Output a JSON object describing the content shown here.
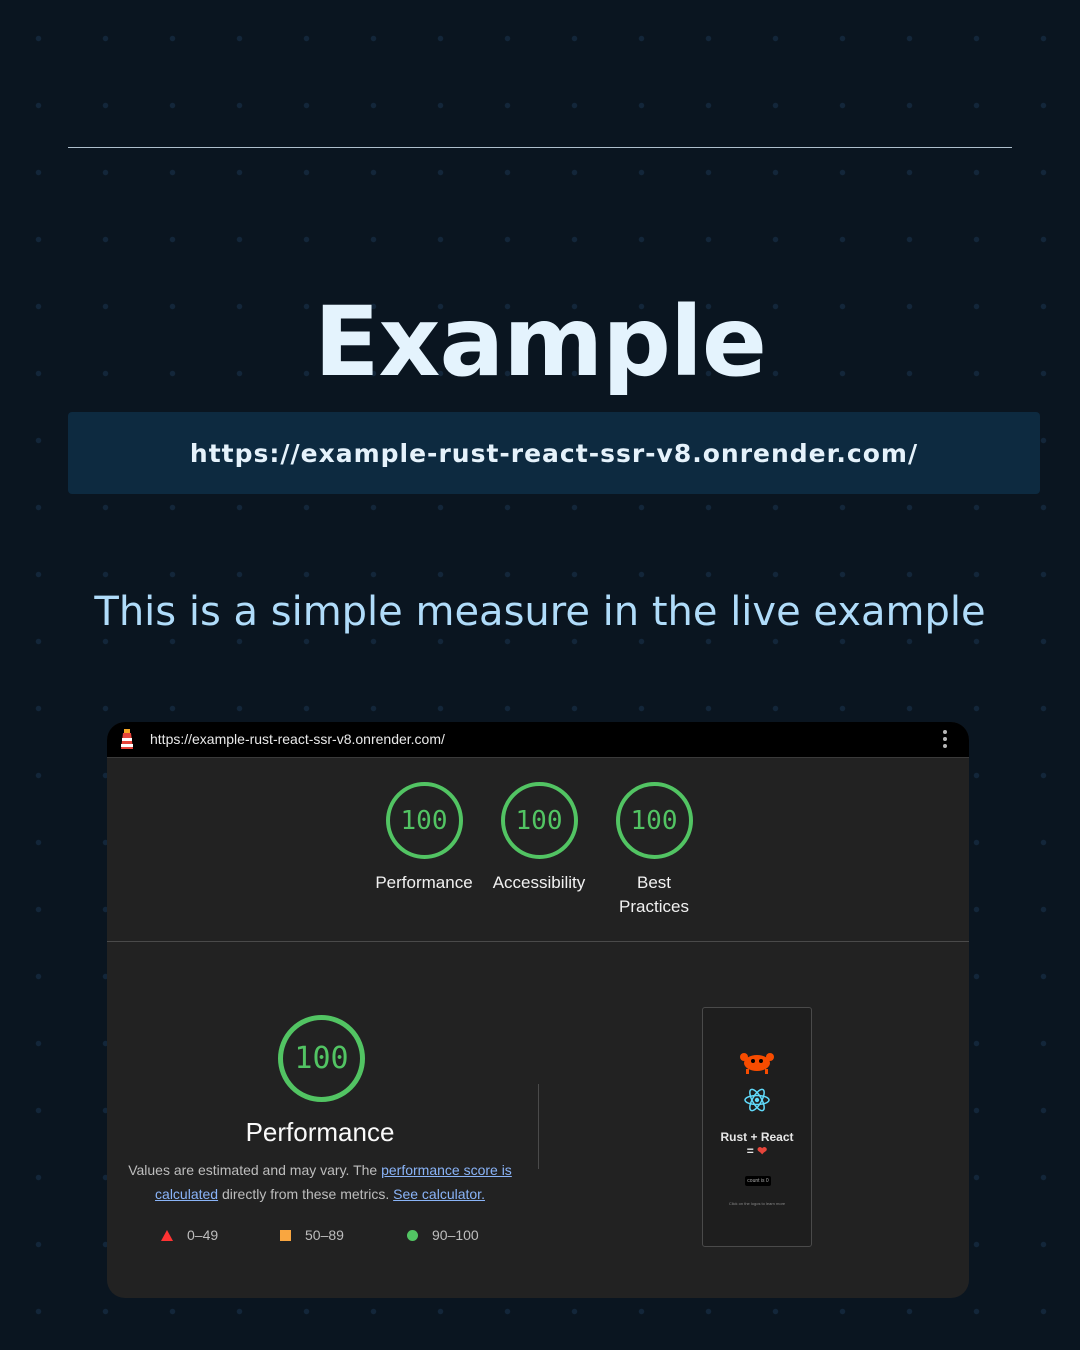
{
  "heading": "Example",
  "url_banner": "https://example-rust-react-ssr-v8.onrender.com/",
  "subtitle": "This is a simple measure in the live example",
  "screenshot": {
    "address_bar": "https://example-rust-react-ssr-v8.onrender.com/",
    "scores": [
      {
        "value": "100",
        "label": "Performance"
      },
      {
        "value": "100",
        "label": "Accessibility"
      },
      {
        "value": "100",
        "label": "Best Practices"
      }
    ],
    "performance": {
      "score": "100",
      "title": "Performance",
      "desc_1": "Values are estimated and may vary. The ",
      "link_score": "performance score is calculated",
      "desc_2": " directly from these metrics. ",
      "link_calc": "See calculator.",
      "legend": [
        "0–49",
        "50–89",
        "90–100"
      ]
    },
    "preview": {
      "title": "Rust + React",
      "equals": "=",
      "button": "count is 0",
      "note": "Click on the logos to learn more"
    }
  },
  "colors": {
    "pass": "#52c463",
    "average": "#f9a640",
    "fail": "#ff3333",
    "accent_url_bg": "#0d2a40"
  }
}
